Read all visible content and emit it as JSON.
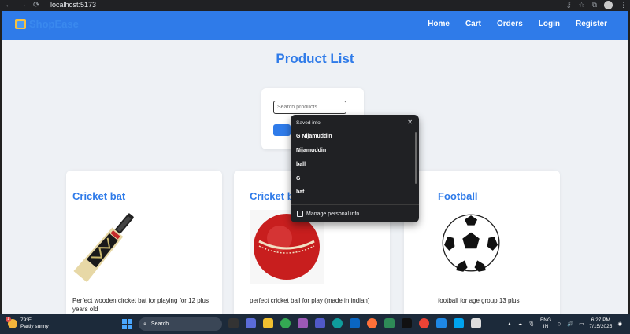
{
  "browser": {
    "url": "localhost:5173"
  },
  "navbar": {
    "brand": "ShopEase",
    "links": [
      "Home",
      "Cart",
      "Orders",
      "Login",
      "Register"
    ]
  },
  "page": {
    "title": "Product List"
  },
  "search": {
    "placeholder": "Search products..."
  },
  "products": [
    {
      "name": "Cricket bat",
      "description": "Perfect wooden circket bat for playing for 12 plus years old"
    },
    {
      "name": "Cricket b",
      "description": "perfect cricket ball for play (made in indian)"
    },
    {
      "name": "Football",
      "description": "football for age group 13 plus"
    }
  ],
  "autofill": {
    "header": "Saved info",
    "items": [
      "G Nijamuddin",
      "Nijamuddin",
      "ball",
      "G",
      "bat"
    ],
    "manage_label": "Manage personal info"
  },
  "taskbar": {
    "temperature": "79°F",
    "condition": "Partly sunny",
    "search_label": "Search",
    "lang_line1": "ENG",
    "lang_line2": "IN",
    "time": "6:27 PM",
    "date": "7/15/2025"
  },
  "colors": {
    "primary": "#2f7be9",
    "popup_bg": "#202124"
  }
}
